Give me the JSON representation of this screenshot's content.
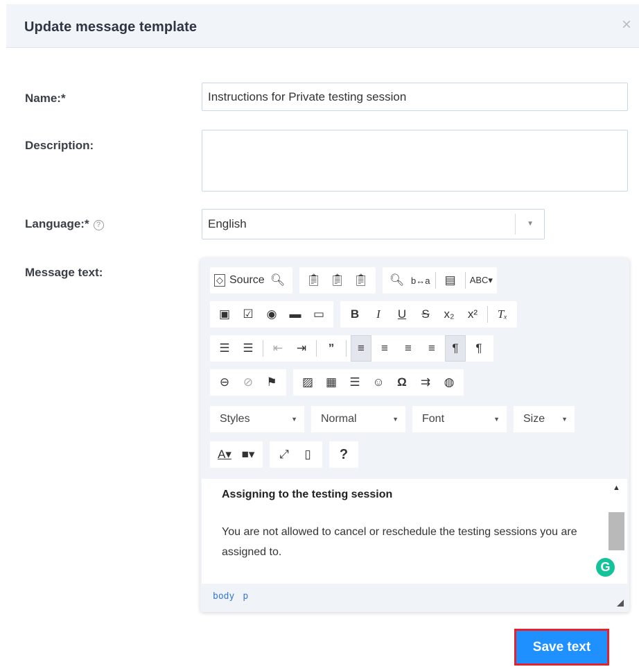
{
  "dialog": {
    "title": "Update message template",
    "close_icon": "×"
  },
  "form": {
    "name_label": "Name:*",
    "name_value": "Instructions for Private testing session",
    "description_label": "Description:",
    "description_value": "",
    "language_label": "Language:*",
    "language_help_icon": "?",
    "language_value": "English",
    "message_label": "Message text:"
  },
  "toolbar": {
    "source_label": "Source",
    "styles_label": "Styles",
    "format_label": "Normal",
    "font_label": "Font",
    "size_label": "Size",
    "help_label": "?"
  },
  "editor": {
    "heading": "Assigning to the testing session",
    "paragraph": "You are not allowed to cancel or reschedule the testing sessions you are assigned to.",
    "path": [
      "body",
      "p"
    ],
    "grammarly_icon": "G"
  },
  "actions": {
    "save_label": "Save text"
  },
  "colors": {
    "primary": "#1e90ff",
    "highlight_border": "#e8202a",
    "grammarly": "#15c39a"
  }
}
